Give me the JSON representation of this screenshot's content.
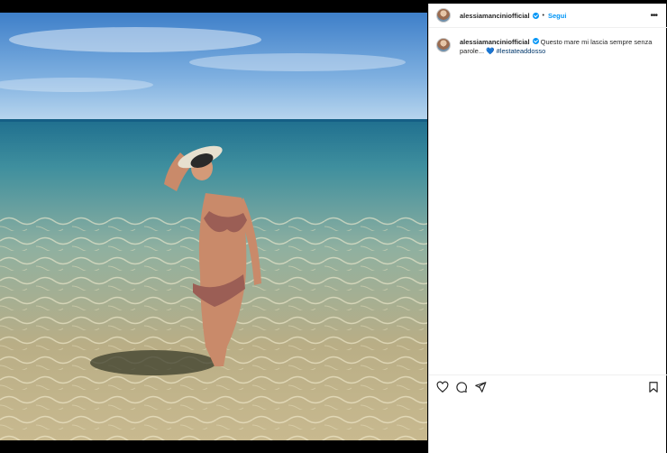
{
  "post": {
    "username": "alessiamanciniofficial",
    "separator": "•",
    "follow_label": "Segui",
    "more_label": "•••",
    "caption_user": "alessiamanciniofficial",
    "caption_text": " Questo mare mi lascia sempre senza parole... ",
    "caption_emoji": "💙",
    "caption_hashtag": " #lestateaddosso"
  },
  "icons": {
    "like": "heart-icon",
    "comment": "comment-icon",
    "share": "share-icon",
    "save": "bookmark-icon",
    "verified": "verified-badge-icon",
    "more": "more-icon"
  },
  "colors": {
    "accent": "#0095f6",
    "text": "#262626",
    "hashtag": "#00376b",
    "border": "#dbdbdb"
  }
}
